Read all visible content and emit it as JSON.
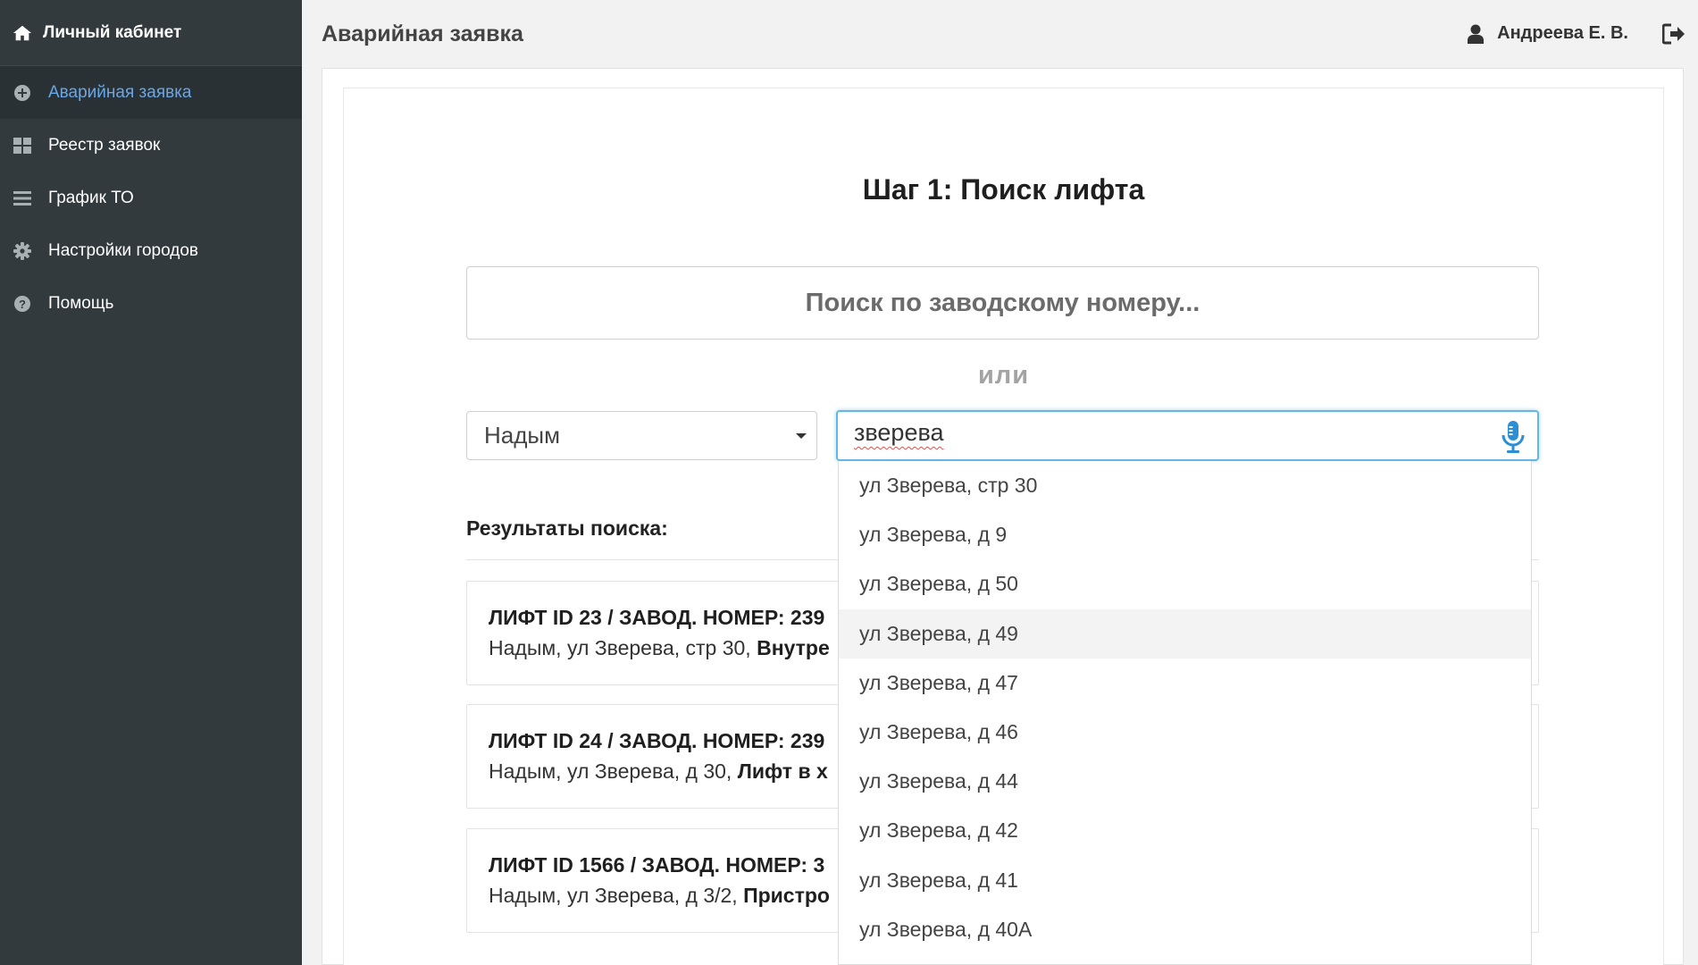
{
  "sidebar": {
    "brand_title": "Личный кабинет",
    "items": [
      {
        "label": "Аварийная заявка",
        "icon": "plus-circle-icon",
        "active": true
      },
      {
        "label": "Реестр заявок",
        "icon": "grid-icon",
        "active": false
      },
      {
        "label": "График ТО",
        "icon": "list-icon",
        "active": false
      },
      {
        "label": "Настройки городов",
        "icon": "gear-icon",
        "active": false
      },
      {
        "label": "Помощь",
        "icon": "question-circle-icon",
        "active": false
      }
    ]
  },
  "header": {
    "title": "Аварийная заявка",
    "user_name": "Андреева Е. В."
  },
  "main": {
    "step_title": "Шаг 1: Поиск лифта",
    "serial_search_placeholder": "Поиск по заводскому номеру...",
    "or_label": "или",
    "city_select_value": "Надым",
    "address_input_value": "зверева",
    "results_title": "Результаты поиска:",
    "results": [
      {
        "line1": "ЛИФТ ID 23 / ЗАВОД. НОМЕР: 239",
        "line2_plain": "Надым, ул Зверева, стр 30, ",
        "line2_bold": "Внутре"
      },
      {
        "line1": "ЛИФТ ID 24 / ЗАВОД. НОМЕР: 239",
        "line2_plain": "Надым, ул Зверева, д 30, ",
        "line2_bold": "Лифт в х"
      },
      {
        "line1": "ЛИФТ ID 1566 / ЗАВОД. НОМЕР: 3",
        "line2_plain": "Надым, ул Зверева, д 3/2, ",
        "line2_bold": "Пристро"
      }
    ]
  },
  "autocomplete": {
    "items": [
      "ул Зверева, стр 30",
      "ул Зверева, д 9",
      "ул Зверева, д 50",
      "ул Зверева, д 49",
      "ул Зверева, д 47",
      "ул Зверева, д 46",
      "ул Зверева, д 44",
      "ул Зверева, д 42",
      "ул Зверева, д 41",
      "ул Зверева, д 40А"
    ],
    "highlighted_index": 3
  },
  "colors": {
    "sidebar_bg": "#323a3d",
    "active_link": "#6aa7e6",
    "input_focus": "#63b7e4",
    "mic_icon": "#2c8fd6"
  }
}
